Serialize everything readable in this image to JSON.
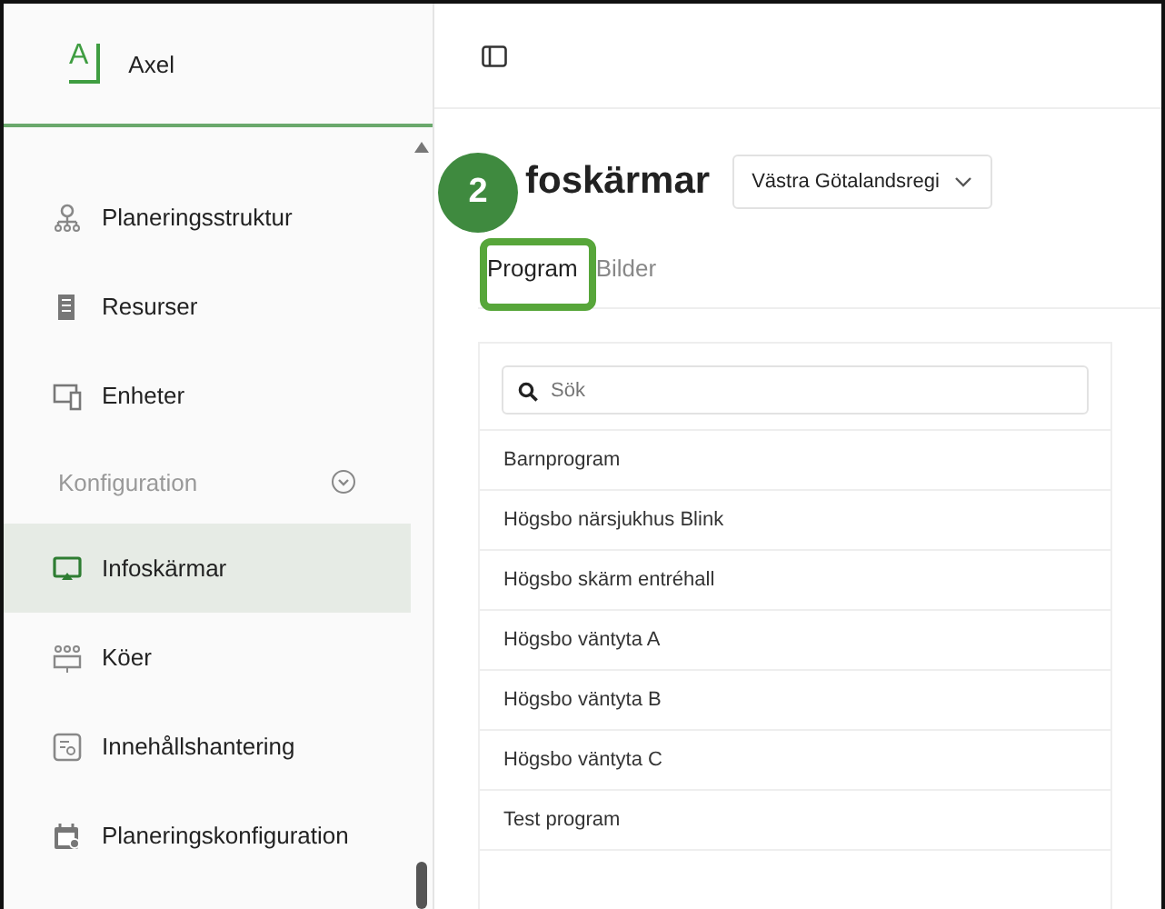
{
  "app": {
    "name": "Axel",
    "logo": "A"
  },
  "sidebar": {
    "items": [
      {
        "kind": "link",
        "label": "Planeringsstruktur",
        "selected": false
      },
      {
        "kind": "link",
        "label": "Resurser",
        "selected": false
      },
      {
        "kind": "link",
        "label": "Enheter",
        "selected": false
      },
      {
        "kind": "section",
        "label": "Konfiguration",
        "expanded": true
      },
      {
        "kind": "link",
        "label": "Infoskärmar",
        "selected": true
      },
      {
        "kind": "link",
        "label": "Köer",
        "selected": false
      },
      {
        "kind": "link",
        "label": "Innehållshantering",
        "selected": false
      },
      {
        "kind": "link",
        "label": "Planeringskonfiguration",
        "selected": false
      }
    ]
  },
  "page": {
    "title": "foskärmar",
    "region": "Västra Götalandsregi",
    "tabs": [
      {
        "label": "Program",
        "selected": true
      },
      {
        "label": "Bilder",
        "selected": false
      }
    ],
    "search": {
      "placeholder": "Sök"
    },
    "programs": [
      "Barnprogram",
      "Högsbo närsjukhus Blink",
      "Högsbo skärm entréhall",
      "Högsbo väntyta A",
      "Högsbo väntyta B",
      "Högsbo väntyta C",
      "Test program"
    ]
  },
  "annotation": {
    "step": "2"
  }
}
